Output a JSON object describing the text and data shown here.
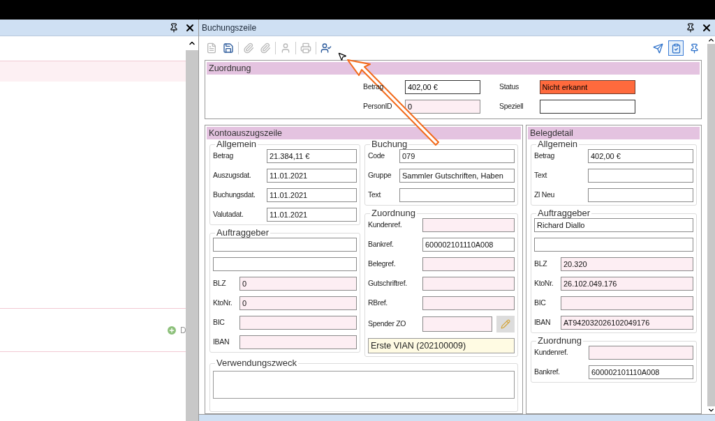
{
  "left_panel": {
    "add_link": {
      "label": "D"
    }
  },
  "buchungszeile": {
    "title": "Buchungszeile",
    "toolbar": [
      {
        "kind": "document",
        "disabled": true
      },
      {
        "kind": "save",
        "disabled": false
      },
      {
        "kind": "clip",
        "disabled": true
      },
      {
        "kind": "clip",
        "disabled": true
      },
      {
        "kind": "person",
        "disabled": true
      },
      {
        "kind": "printer",
        "disabled": true
      },
      {
        "kind": "person-assign",
        "disabled": false
      }
    ],
    "toolbar_right": [
      {
        "kind": "send",
        "selected": false
      },
      {
        "kind": "checklist",
        "selected": true
      },
      {
        "kind": "pin",
        "selected": false
      }
    ],
    "zuordnung": {
      "title": "Zuordnung",
      "fields": [
        {
          "label": "Betrag",
          "value": "402,00 €",
          "kind": "plain"
        },
        {
          "label": "Status",
          "value": "Nicht erkannt",
          "kind": "alert"
        },
        {
          "label": "PersonID",
          "value": "0",
          "kind": "tinted"
        },
        {
          "label": "Speziell",
          "kind": "plain"
        }
      ]
    },
    "kontoauszugszeile": {
      "title": "Kontoauszugszeile",
      "allgemein": {
        "title": "Allgemein",
        "fields": [
          {
            "label": "Betrag",
            "value": "21.384,11 €",
            "tinted": false
          },
          {
            "label": "Auszugsdat.",
            "value": "11.01.2021",
            "tinted": false
          },
          {
            "label": "Buchungsdat.",
            "value": "11.01.2021",
            "tinted": false
          },
          {
            "label": "Valutadat.",
            "value": "11.01.2021",
            "tinted": false
          }
        ]
      },
      "auftraggeber": {
        "title": "Auftraggeber",
        "fields": [
          {
            "tinted": false
          },
          {
            "tinted": false
          },
          {
            "label": "BLZ",
            "value": "0",
            "tinted": true
          },
          {
            "label": "KtoNr.",
            "value": "0",
            "tinted": true
          },
          {
            "label": "BIC",
            "tinted": true
          },
          {
            "label": "IBAN",
            "tinted": true
          }
        ]
      },
      "buchung": {
        "title": "Buchung",
        "fields": [
          {
            "label": "Code",
            "value": "079",
            "tinted": false
          },
          {
            "label": "Gruppe",
            "value": "Sammler Gutschriften, Haben",
            "tinted": false
          },
          {
            "label": "Text",
            "tinted": false
          }
        ]
      },
      "zuordnung": {
        "title": "Zuordnung",
        "fields": [
          {
            "label": "Kundenref.",
            "tinted": true
          },
          {
            "label": "Bankref.",
            "value": "600002101110A008",
            "tinted": false
          },
          {
            "label": "Belegref.",
            "tinted": true
          },
          {
            "label": "Gutschriftref.",
            "tinted": true
          },
          {
            "label": "RBref.",
            "tinted": true
          },
          {
            "label": "Spender ZO",
            "tinted": true
          }
        ],
        "donor": "Erste VIAN (202100009)"
      },
      "verwendungszweck": {
        "title": "Verwendungszweck"
      }
    },
    "belegdetail": {
      "title": "Belegdetail",
      "allgemein": {
        "title": "Allgemein",
        "fields": [
          {
            "label": "Betrag",
            "value": "402,00 €",
            "tinted": false
          },
          {
            "label": "Text",
            "tinted": false
          },
          {
            "label": "Zl Neu",
            "tinted": false
          }
        ]
      },
      "auftraggeber": {
        "title": "Auftraggeber",
        "fields": [
          {
            "value": "Richard Diallo",
            "tinted": false
          },
          {
            "tinted": false
          },
          {
            "label": "BLZ",
            "value": "20.320",
            "tinted": true
          },
          {
            "label": "KtoNr.",
            "value": "26.102.049.176",
            "tinted": true
          },
          {
            "label": "BIC",
            "tinted": true
          },
          {
            "label": "IBAN",
            "value": "AT942032026102049176",
            "tinted": true
          }
        ]
      },
      "zuordnung": {
        "title": "Zuordnung",
        "fields": [
          {
            "label": "Kundenref.",
            "tinted": true
          },
          {
            "label": "Bankref.",
            "value": "600002101110A008",
            "tinted": false
          }
        ]
      }
    }
  }
}
